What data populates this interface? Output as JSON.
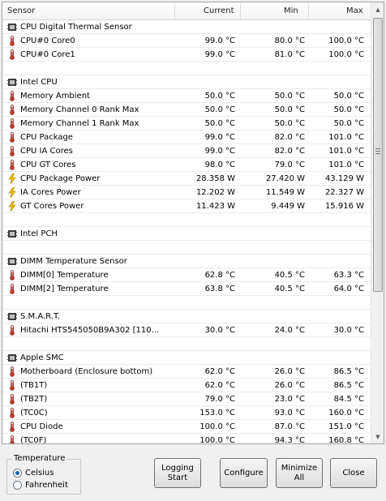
{
  "header": {
    "sensor": "Sensor",
    "current": "Current",
    "min": "Min",
    "max": "Max"
  },
  "rows": [
    {
      "type": "group",
      "name": "CPU Digital Thermal Sensor"
    },
    {
      "type": "temp",
      "name": "CPU#0 Core0",
      "current": "99.0 °C",
      "min": "80.0 °C",
      "max": "100.0 °C"
    },
    {
      "type": "temp",
      "name": "CPU#0 Core1",
      "current": "99.0 °C",
      "min": "81.0 °C",
      "max": "100.0 °C"
    },
    {
      "type": "blank"
    },
    {
      "type": "group",
      "name": "Intel CPU"
    },
    {
      "type": "temp",
      "name": "Memory Ambient",
      "current": "50.0 °C",
      "min": "50.0 °C",
      "max": "50.0 °C"
    },
    {
      "type": "temp",
      "name": "Memory Channel 0 Rank Max",
      "current": "50.0 °C",
      "min": "50.0 °C",
      "max": "50.0 °C"
    },
    {
      "type": "temp",
      "name": "Memory Channel 1 Rank Max",
      "current": "50.0 °C",
      "min": "50.0 °C",
      "max": "50.0 °C"
    },
    {
      "type": "temp",
      "name": "CPU Package",
      "current": "99.0 °C",
      "min": "82.0 °C",
      "max": "101.0 °C"
    },
    {
      "type": "temp",
      "name": "CPU IA Cores",
      "current": "99.0 °C",
      "min": "82.0 °C",
      "max": "101.0 °C"
    },
    {
      "type": "temp",
      "name": "CPU GT Cores",
      "current": "98.0 °C",
      "min": "79.0 °C",
      "max": "101.0 °C"
    },
    {
      "type": "power",
      "name": "CPU Package Power",
      "current": "28.358 W",
      "min": "27.420 W",
      "max": "43.129 W"
    },
    {
      "type": "power",
      "name": "IA Cores Power",
      "current": "12.202 W",
      "min": "11.549 W",
      "max": "22.327 W"
    },
    {
      "type": "power",
      "name": "GT Cores Power",
      "current": "11.423 W",
      "min": "9.449 W",
      "max": "15.916 W"
    },
    {
      "type": "blank"
    },
    {
      "type": "group",
      "name": "Intel PCH"
    },
    {
      "type": "blank"
    },
    {
      "type": "group",
      "name": "DIMM Temperature Sensor"
    },
    {
      "type": "temp",
      "name": "DIMM[0] Temperature",
      "current": "62.8 °C",
      "min": "40.5 °C",
      "max": "63.3 °C"
    },
    {
      "type": "temp",
      "name": "DIMM[2] Temperature",
      "current": "63.8 °C",
      "min": "40.5 °C",
      "max": "64.0 °C"
    },
    {
      "type": "blank"
    },
    {
      "type": "group",
      "name": "S.M.A.R.T."
    },
    {
      "type": "temp",
      "name": "Hitachi HTS545050B9A302 [110...",
      "current": "30.0 °C",
      "min": "24.0 °C",
      "max": "30.0 °C"
    },
    {
      "type": "blank"
    },
    {
      "type": "group",
      "name": "Apple SMC"
    },
    {
      "type": "temp",
      "name": "Motherboard (Enclosure bottom)",
      "current": "62.0 °C",
      "min": "26.0 °C",
      "max": "86.5 °C"
    },
    {
      "type": "temp",
      "name": "(TB1T)",
      "current": "62.0 °C",
      "min": "26.0 °C",
      "max": "86.5 °C"
    },
    {
      "type": "temp",
      "name": "(TB2T)",
      "current": "79.0 °C",
      "min": "23.0 °C",
      "max": "84.5 °C"
    },
    {
      "type": "temp",
      "name": "(TC0C)",
      "current": "153.0 °C",
      "min": "93.0 °C",
      "max": "160.0 °C"
    },
    {
      "type": "temp",
      "name": "CPU Diode",
      "current": "100.0 °C",
      "min": "87.0 °C",
      "max": "151.0 °C"
    },
    {
      "type": "temp",
      "name": "(TC0F)",
      "current": "100.0 °C",
      "min": "94.3 °C",
      "max": "160.8 °C"
    }
  ],
  "temperature_group": {
    "title": "Temperature",
    "celsius": "Celsius",
    "fahrenheit": "Fahrenheit",
    "selected": "Celsius"
  },
  "buttons": {
    "logging": "Logging\nStart",
    "configure": "Configure",
    "minimize": "Minimize\nAll",
    "close": "Close"
  },
  "colors": {
    "thermo_red": "#c0392b",
    "bolt_yellow": "#f2c200",
    "chip_dark": "#404040"
  }
}
